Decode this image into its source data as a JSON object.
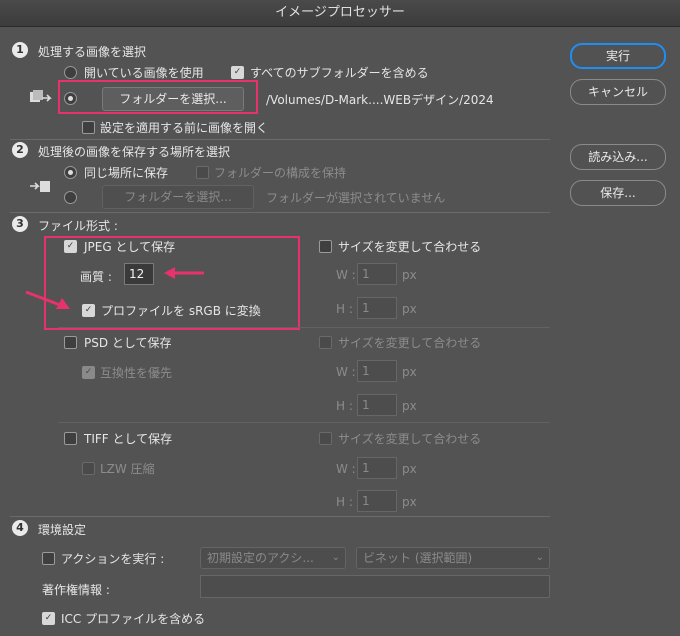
{
  "window": {
    "title": "イメージプロセッサー"
  },
  "buttons": {
    "run": "実行",
    "cancel": "キャンセル",
    "load": "読み込み...",
    "save": "保存..."
  },
  "section1": {
    "num": "1",
    "heading": "処理する画像を選択",
    "use_open_images": "開いている画像を使用",
    "include_subfolders": "すべてのサブフォルダーを含める",
    "select_folder_button": "フォルダーを選択...",
    "folder_path": "/Volumes/D-Mark....WEBデザイン/2024",
    "open_first": "設定を適用する前に画像を開く"
  },
  "section2": {
    "num": "2",
    "heading": "処理後の画像を保存する場所を選択",
    "same_location": "同じ場所に保存",
    "keep_structure": "フォルダーの構成を保持",
    "select_folder_button": "フォルダーを選択...",
    "no_folder": "フォルダーが選択されていません"
  },
  "section3": {
    "num": "3",
    "heading": "ファイル形式 :",
    "jpeg": {
      "save_as": "JPEG として保存",
      "quality_label": "画質 :",
      "quality_value": "12",
      "convert_srgb": "プロファイルを sRGB に変換",
      "resize": "サイズを変更して合わせる",
      "w_label": "W :",
      "w_value": "1",
      "h_label": "H :",
      "h_value": "1",
      "unit": "px"
    },
    "psd": {
      "save_as": "PSD として保存",
      "maximize": "互換性を優先",
      "resize": "サイズを変更して合わせる",
      "w_label": "W :",
      "w_value": "1",
      "h_label": "H :",
      "h_value": "1",
      "unit": "px"
    },
    "tiff": {
      "save_as": "TIFF として保存",
      "lzw": "LZW 圧縮",
      "resize": "サイズを変更して合わせる",
      "w_label": "W :",
      "w_value": "1",
      "h_label": "H :",
      "h_value": "1",
      "unit": "px"
    }
  },
  "section4": {
    "num": "4",
    "heading": "環境設定",
    "run_action": "アクションを実行 :",
    "action_set": "初期設定のアクシ...",
    "action_name": "ビネット (選択範囲)",
    "copyright_label": "著作権情報 :",
    "copyright_value": "",
    "include_icc": "ICC プロファイルを含める"
  },
  "colors": {
    "highlight": "#e8326b",
    "primary_focus": "#1f8ef3",
    "background": "#535353"
  },
  "icons": {
    "step_icon": "image-stack-arrow-icon",
    "annotation": "pink-arrow-icon"
  }
}
